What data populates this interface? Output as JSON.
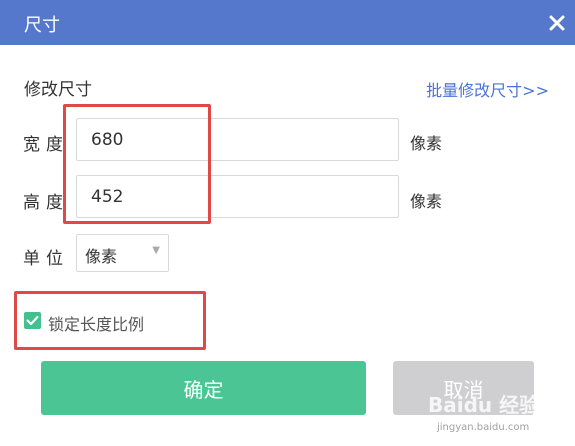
{
  "dialog": {
    "title": "尺寸",
    "section_title": "修改尺寸",
    "batch_link": "批量修改尺寸>>"
  },
  "width_row": {
    "label": "宽度",
    "value": "680",
    "unit": "像素"
  },
  "height_row": {
    "label": "高度",
    "value": "452",
    "unit": "像素"
  },
  "unit_row": {
    "label": "单位",
    "selected": "像素"
  },
  "lock_ratio": {
    "label": "锁定长度比例",
    "checked": true
  },
  "buttons": {
    "ok": "确定",
    "cancel": "取消"
  },
  "watermark": {
    "text": "Baidu 经验",
    "url": "jingyan.baidu.com"
  },
  "colors": {
    "titlebar": "#5577cc",
    "link": "#4b73d6",
    "ok_button": "#4cc594",
    "cancel_button": "#cfcfd2",
    "checkbox": "#44c08f",
    "annotation": "#e14848"
  },
  "icons": {
    "close": "close-icon",
    "check": "check-icon",
    "dropdown": "chevron-down-icon"
  }
}
